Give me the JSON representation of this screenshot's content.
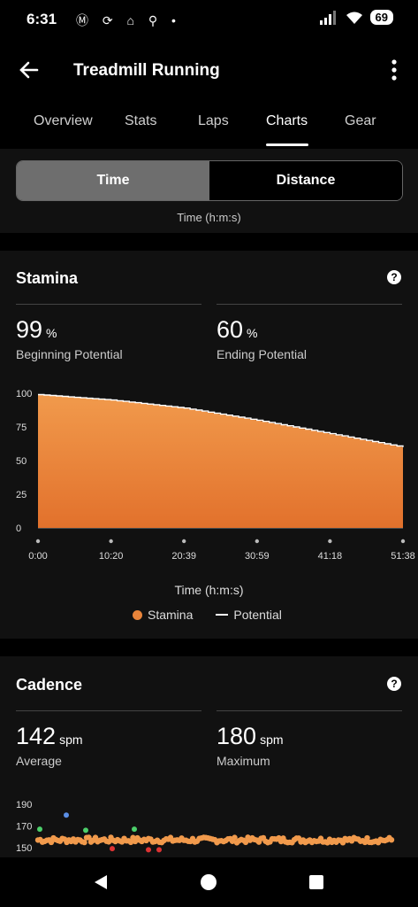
{
  "status": {
    "time": "6:31",
    "battery": "69",
    "left_icons": "Ⓜ ⟳ ⌂ ⚲ •"
  },
  "header": {
    "title": "Treadmill Running"
  },
  "tabs": [
    "Overview",
    "Stats",
    "Laps",
    "Charts",
    "Gear"
  ],
  "active_tab": "Charts",
  "segment": {
    "left": "Time",
    "right": "Distance",
    "selected": "Time"
  },
  "cut_axis_label": "Time (h:m:s)",
  "stamina": {
    "title": "Stamina",
    "begin_value": "99",
    "begin_unit": "%",
    "begin_label": "Beginning Potential",
    "end_value": "60",
    "end_unit": "%",
    "end_label": "Ending Potential",
    "x_axis_label": "Time (h:m:s)",
    "legend_stamina": "Stamina",
    "legend_potential": "Potential"
  },
  "cadence": {
    "title": "Cadence",
    "avg_value": "142",
    "avg_unit": "spm",
    "avg_label": "Average",
    "max_value": "180",
    "max_unit": "spm",
    "max_label": "Maximum"
  },
  "colors": {
    "accent": "#e8843a",
    "accent_light": "#f19a4c",
    "card_bg": "#111111"
  },
  "chart_data": [
    {
      "type": "area",
      "title": "",
      "xlabel": "Time (h:m:s)",
      "ylabel": "",
      "x_ticks": [
        "0:00",
        "10:20",
        "20:39",
        "30:59",
        "41:18",
        "51:38"
      ],
      "y_ticks": [
        0,
        25,
        50,
        75,
        100
      ],
      "ylim": [
        0,
        100
      ],
      "x_minutes": [
        0,
        10.33,
        20.65,
        30.98,
        41.3,
        51.63
      ],
      "series": [
        {
          "name": "Stamina",
          "values": [
            99,
            95,
            89,
            80,
            70,
            60
          ]
        },
        {
          "name": "Potential",
          "values": [
            99,
            95,
            89,
            80,
            70,
            60
          ]
        }
      ],
      "legend": "bottom"
    },
    {
      "type": "scatter",
      "title": "",
      "y_ticks": [
        150,
        170,
        190
      ],
      "ylim": [
        145,
        195
      ],
      "note_values_typical": 157
    }
  ]
}
